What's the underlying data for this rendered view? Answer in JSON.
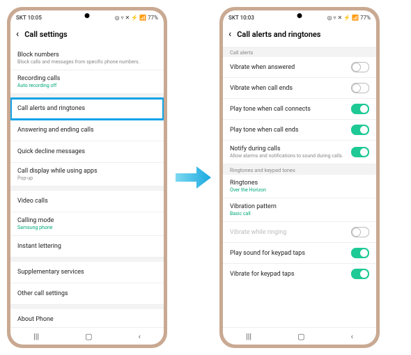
{
  "statusbar": {
    "carrier_time_left": "SKT 10:05",
    "carrier_time_right": "SKT 10:03",
    "battery": "77%",
    "icons": "◎ ▿ ✕ ⚡ 📶 77%"
  },
  "screen1": {
    "title": "Call settings",
    "items": [
      {
        "title": "Block numbers",
        "subtitle": "Block calls and messages from specific phone numbers."
      },
      {
        "title": "Recording calls",
        "subtitle": "Auto recording off",
        "accent": true
      },
      {
        "title": "Call alerts and ringtones",
        "highlight": true
      },
      {
        "title": "Answering and ending calls"
      },
      {
        "title": "Quick decline messages"
      },
      {
        "title": "Call display while using apps",
        "subtitle": "Pop-up"
      },
      {
        "title": "Video calls"
      },
      {
        "title": "Calling mode",
        "subtitle": "Samsung phone",
        "accent": true
      },
      {
        "title": "Instant lettering"
      },
      {
        "title": "Supplementary services"
      },
      {
        "title": "Other call settings"
      },
      {
        "title": "About Phone"
      }
    ]
  },
  "screen2": {
    "title": "Call alerts and ringtones",
    "section1": "Call alerts",
    "section2": "Ringtones and keypad tones",
    "items1": [
      {
        "title": "Vibrate when answered",
        "toggle": "off"
      },
      {
        "title": "Vibrate when call ends",
        "toggle": "off"
      },
      {
        "title": "Play tone when call connects",
        "toggle": "on"
      },
      {
        "title": "Play tone when call ends",
        "toggle": "on"
      },
      {
        "title": "Notify during calls",
        "subtitle": "Allow alarms and notifications to sound during calls.",
        "toggle": "on"
      }
    ],
    "items2": [
      {
        "title": "Ringtones",
        "subtitle": "Over the Horizon",
        "accent": true
      },
      {
        "title": "Vibration pattern",
        "subtitle": "Basic call",
        "accent": true
      },
      {
        "title": "Vibrate while ringing",
        "toggle": "off",
        "disabled": true
      },
      {
        "title": "Play sound for keypad taps",
        "toggle": "on"
      },
      {
        "title": "Vibrate for keypad taps",
        "toggle": "on"
      }
    ]
  },
  "nav": {
    "recent": "|||",
    "home": "▢",
    "back": "<"
  }
}
